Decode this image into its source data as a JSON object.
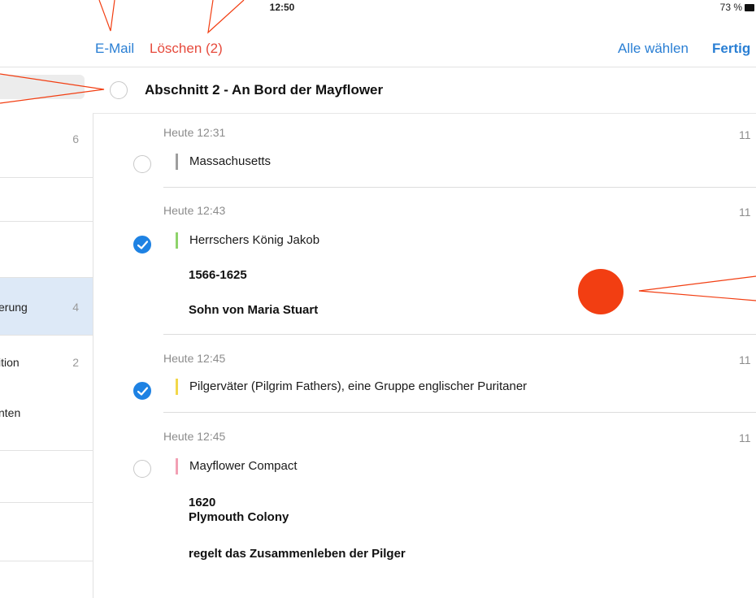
{
  "status_bar": {
    "time": "12:50",
    "battery": "73 %"
  },
  "toolbar": {
    "email_label": "E-Mail",
    "delete_label": "Löschen (2)",
    "select_all_label": "Alle wählen",
    "done_label": "Fertig"
  },
  "sidebar": {
    "items": [
      {
        "label": "",
        "count": "6"
      },
      {
        "label": "",
        "count": ""
      },
      {
        "label": "",
        "count": ""
      },
      {
        "label": "erung",
        "count": "4"
      },
      {
        "label": "ition",
        "count": "2"
      },
      {
        "label": "nten",
        "count": ""
      },
      {
        "label": "",
        "count": ""
      },
      {
        "label": "",
        "count": ""
      }
    ]
  },
  "section": {
    "title": "Abschnitt 2 - An Bord der Mayflower",
    "selected": false
  },
  "notes": [
    {
      "time": "Heute 12:31",
      "number": "11",
      "title": "Massachusetts",
      "lines": [],
      "selected": false,
      "color": "#9e9e9e"
    },
    {
      "time": "Heute 12:43",
      "number": "11",
      "title": "Herrschers König Jakob",
      "lines": [
        "1566-1625",
        "Sohn von Maria Stuart"
      ],
      "selected": true,
      "color": "#8ed36b"
    },
    {
      "time": "Heute 12:45",
      "number": "11",
      "title": "Pilgerväter (Pilgrim Fathers), eine Gruppe englischer Puritaner",
      "lines": [],
      "selected": true,
      "color": "#f2d74a"
    },
    {
      "time": "Heute 12:45",
      "number": "11",
      "title": "Mayflower Compact",
      "lines": [
        "1620",
        "Plymouth Colony",
        "regelt das Zusammenleben der Pilger"
      ],
      "selected": false,
      "color": "#f2a0b4"
    }
  ],
  "colors": {
    "accent": "#2a7fd4",
    "delete": "#e64a3c",
    "check": "#1e82e3",
    "annotation": "#f23e12"
  }
}
